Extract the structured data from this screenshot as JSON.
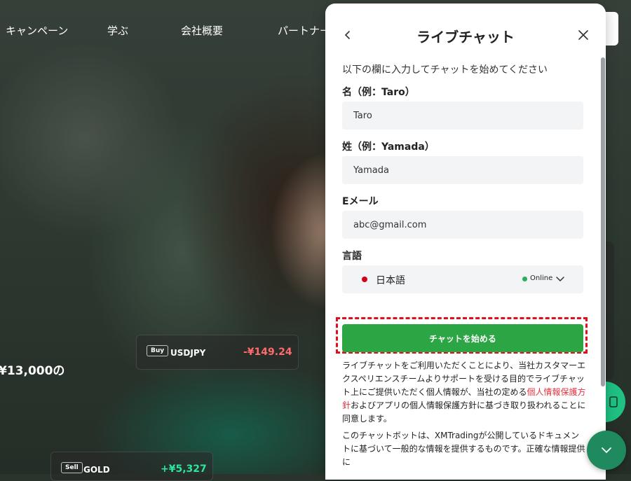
{
  "nav": {
    "items": [
      "キャンペーン",
      "学ぶ",
      "会社概要",
      "パートナー"
    ]
  },
  "hero": {
    "promo_amount": "¥13,000の",
    "tickers": [
      {
        "tag": "Buy",
        "symbol": "USDJPY",
        "price": "-¥149.24",
        "price_color": "#ff6b6b"
      },
      {
        "tag": "Sell",
        "symbol": "GOLD",
        "price": "+¥5,327",
        "price_color": "#2ee59d"
      }
    ]
  },
  "chat": {
    "title": "ライブチャット",
    "intro": "以下の欄に入力してチャットを始めてください",
    "first_name": {
      "label": "名（例：Taro）",
      "value": "Taro"
    },
    "last_name": {
      "label": "姓（例：Yamada）",
      "value": "Yamada"
    },
    "email": {
      "label": "Eメール",
      "value": "abc@gmail.com"
    },
    "language": {
      "label": "言語",
      "value": "日本語",
      "status": "Online"
    },
    "start_button": "チャットを始める",
    "consent_before": "ライブチャットをご利用いただくことにより、当社カスタマーエクスペリエンスチームよりサポートを受ける目的でライブチャット上にご提供いただく個人情報が、当社の定める",
    "consent_link": "個人情報保護方針",
    "consent_after": "およびアプリの個人情報保護方針に基づき取り扱われることに同意します。",
    "disclaimer": "このチャットボットは、XMTradingが公開しているドキュメントに基づいて一般的な情報を提供するものです。正確な情報提供に"
  },
  "colors": {
    "accent_green": "#2ca645",
    "highlight_red": "#e0101a",
    "link_red": "#e0343f",
    "online_green": "#27ae60"
  }
}
